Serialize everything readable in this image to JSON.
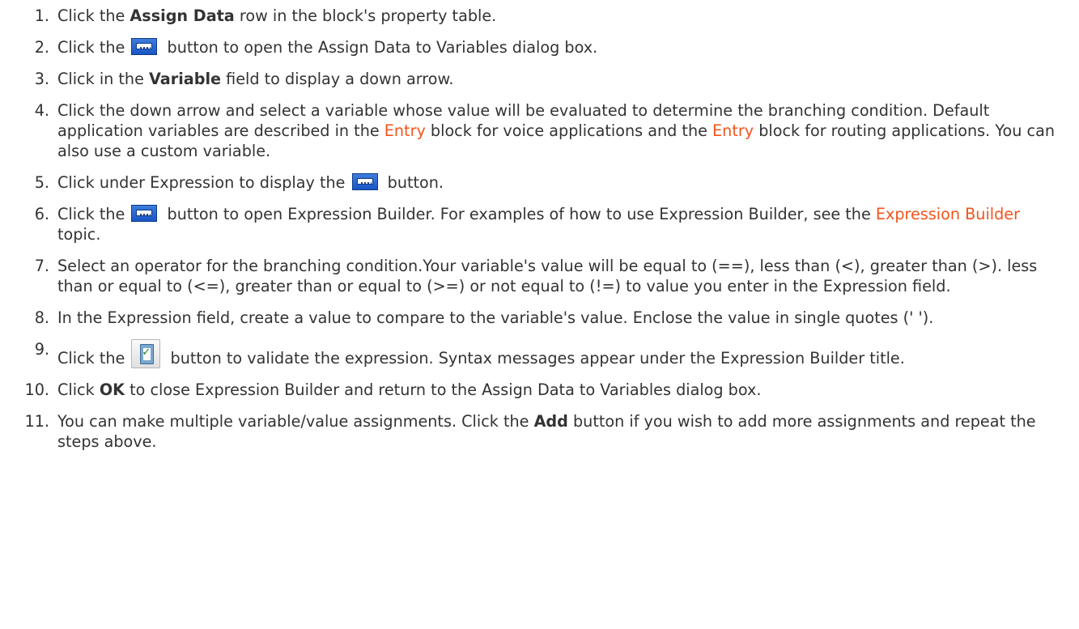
{
  "steps": [
    {
      "number": "1.",
      "before": "Click the ",
      "bold": "Assign Data",
      "after": " row in the block's property table."
    },
    {
      "number": "2.",
      "before": "Click the ",
      "icon": "ellipsis-button-icon",
      "after": " button to open the Assign Data to Variables dialog box."
    },
    {
      "number": "3.",
      "before": "Click in the ",
      "bold": "Variable",
      "after": " field to display a down arrow."
    },
    {
      "number": "4.",
      "text_a": "Click the down arrow and select a variable whose value will be evaluated to determine the branching condition. Default application variables are described in the ",
      "link1": "Entry",
      "text_b": " block for voice applications and the ",
      "link2": "Entry",
      "text_c": " block for routing applications. You can also use a custom variable."
    },
    {
      "number": "5.",
      "before": "Click under Expression to display the ",
      "icon": "ellipsis-button-icon",
      "after": " button."
    },
    {
      "number": "6.",
      "before": "Click the ",
      "icon": "ellipsis-button-icon",
      "middle": " button to open Expression Builder. For examples of how to use Expression Builder, see the ",
      "link": "Expression Builder",
      "after": " topic."
    },
    {
      "number": "7.",
      "text": "Select an operator for the branching condition.Your variable's value will be equal to (==), less than (<), greater than (>). less than or equal to (<=), greater than or equal to (>=) or not equal to (!=) to value you enter in the Expression field."
    },
    {
      "number": "8.",
      "text": "In the Expression field, create a value to compare to the variable's value. Enclose the value in single quotes ('  ')."
    },
    {
      "number": "9.",
      "before": "Click the ",
      "icon": "validate-button-icon",
      "after": " button to validate the expression. Syntax messages appear under the Expression Builder title."
    },
    {
      "number": "10.",
      "before": "Click ",
      "bold": "OK",
      "after": " to close Expression Builder and return to the Assign Data to Variables dialog box."
    },
    {
      "number": "11.",
      "before": "You can make multiple variable/value assignments. Click the ",
      "bold": "Add",
      "after": " button if you wish to add more assignments and repeat the steps above."
    }
  ],
  "colors": {
    "text": "#333333",
    "link": "#f2541b"
  }
}
